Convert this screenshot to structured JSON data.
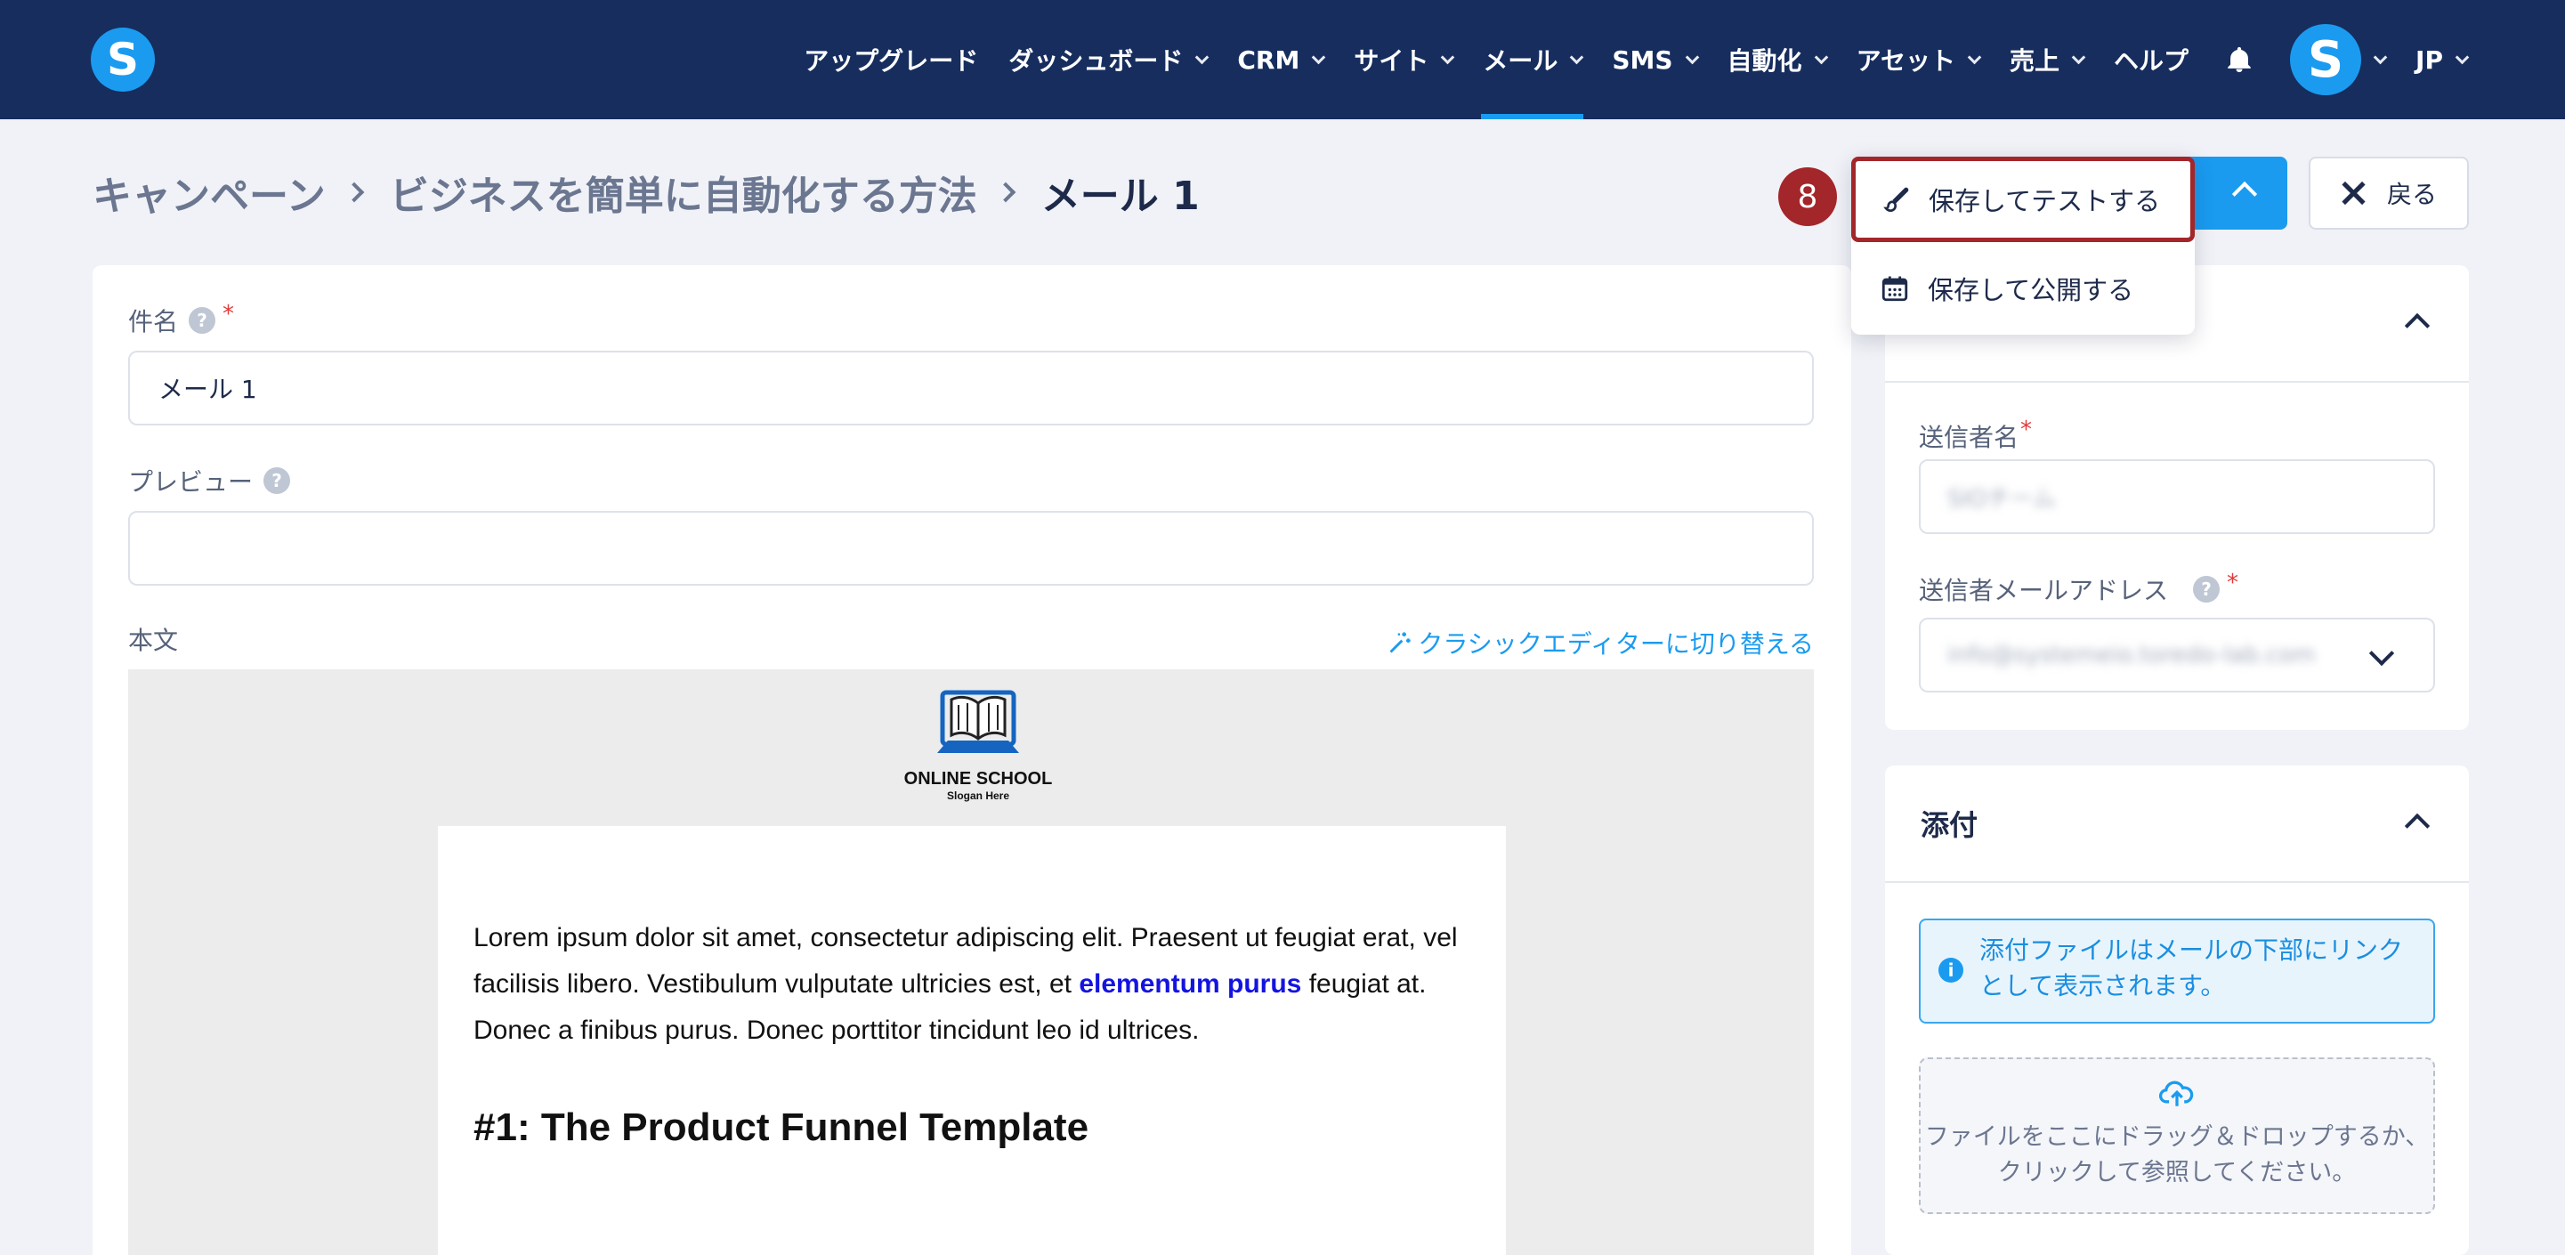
{
  "nav": {
    "logo_letter": "S",
    "items": [
      {
        "label": "アップグレード",
        "dropdown": false
      },
      {
        "label": "ダッシュボード",
        "dropdown": true
      },
      {
        "label": "CRM",
        "dropdown": true
      },
      {
        "label": "サイト",
        "dropdown": true
      },
      {
        "label": "メール",
        "dropdown": true,
        "active": true
      },
      {
        "label": "SMS",
        "dropdown": true
      },
      {
        "label": "自動化",
        "dropdown": true
      },
      {
        "label": "アセット",
        "dropdown": true
      },
      {
        "label": "売上",
        "dropdown": true
      },
      {
        "label": "ヘルプ",
        "dropdown": false
      }
    ],
    "avatar_letter": "S",
    "language": "JP"
  },
  "breadcrumb": {
    "level1": "キャンペーン",
    "level2": "ビジネスを簡単に自動化する方法",
    "current": "メール 1"
  },
  "actions": {
    "save_test": "保存してテストする",
    "save_publish": "保存して公開する",
    "back": "戻る",
    "step_number": "8"
  },
  "form": {
    "subject_label": "件名",
    "subject_value": "メール 1",
    "preview_label": "プレビュー",
    "preview_value": "",
    "body_label": "本文",
    "switch_editor": "クラシックエディターに切り替える",
    "help_glyph": "?",
    "required_mark": "*"
  },
  "email": {
    "logo_name": "ONLINE SCHOOL",
    "logo_slogan": "Slogan Here",
    "paragraph_before": "Lorem ipsum dolor sit amet, consectetur adipiscing elit. Praesent ut feugiat erat, vel facilisis libero. Vestibulum vulputate ultricies est, et ",
    "paragraph_link": "elementum purus",
    "paragraph_after": " feugiat at. Donec a finibus purus. Donec porttitor tincidunt leo id ultrices.",
    "heading": "#1: The Product Funnel Template"
  },
  "sender": {
    "name_label": "送信者名",
    "name_value": "SIOチーム",
    "email_label": "送信者メールアドレス",
    "email_value": "info@systemeio.toredo-lab.com"
  },
  "attachments": {
    "title": "添付",
    "info": "添付ファイルはメールの下部にリンクとして表示されます。",
    "info_glyph": "i",
    "dropzone_text": "ファイルをここにドラッグ＆ドロップするか、クリックして参照してください。"
  },
  "colors": {
    "nav_bg": "#162d5e",
    "accent": "#1a9bf0",
    "highlight": "#a3262a",
    "page_bg": "#f0f2f7"
  }
}
